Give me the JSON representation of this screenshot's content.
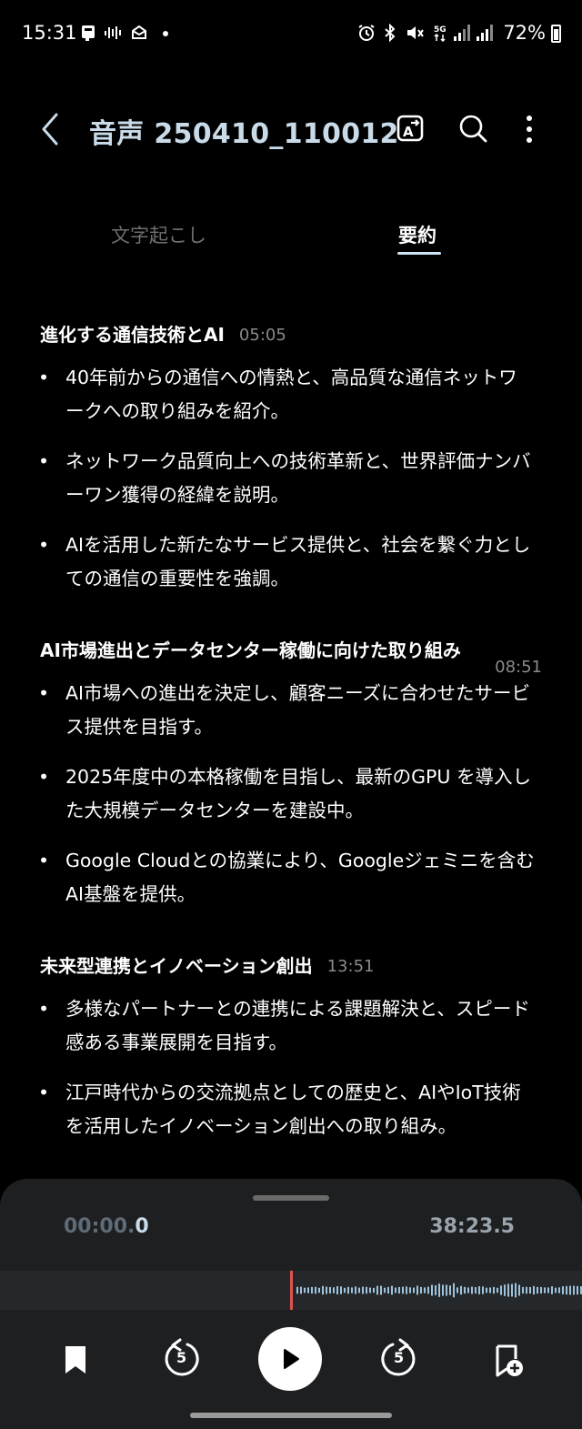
{
  "status_bar": {
    "time": "15:31",
    "battery": "72%"
  },
  "header": {
    "title": "音声 250410_110012"
  },
  "tabs": [
    {
      "label": "文字起こし",
      "active": false
    },
    {
      "label": "要約",
      "active": true
    }
  ],
  "sections": [
    {
      "title": "進化する通信技術とAI",
      "time": "05:05",
      "bullets": [
        "40年前からの通信への情熱と、高品質な通信ネットワークへの取り組みを紹介。",
        "ネットワーク品質向上への技術革新と、世界評価ナンバーワン獲得の経緯を説明。",
        "AIを活用した新たなサービス提供と、社会を繋ぐ力としての通信の重要性を強調。"
      ]
    },
    {
      "title": "AI市場進出とデータセンター稼働に向けた取り組み",
      "time": "08:51",
      "bullets": [
        "AI市場への進出を決定し、顧客ニーズに合わせたサービス提供を目指す。",
        "2025年度中の本格稼働を目指し、最新のGPU を導入した大規模データセンターを建設中。",
        "Google Cloudとの協業により、Googleジェミニを含むAI基盤を提供。"
      ]
    },
    {
      "title": "未来型連携とイノベーション創出",
      "time": "13:51",
      "bullets": [
        "多様なパートナーとの連携による課題解決と、スピード感ある事業展開を目指す。",
        "江戸時代からの交流拠点としての歴史と、AIやIoT技術を活用したイノベーション創出への取り組み。"
      ]
    }
  ],
  "player": {
    "current_time_main": "00:00.",
    "current_time_frac": "0",
    "total_time": "38:23.5",
    "skip_back_seconds": "5",
    "skip_forward_seconds": "5",
    "accent_color": "#e0524d"
  }
}
